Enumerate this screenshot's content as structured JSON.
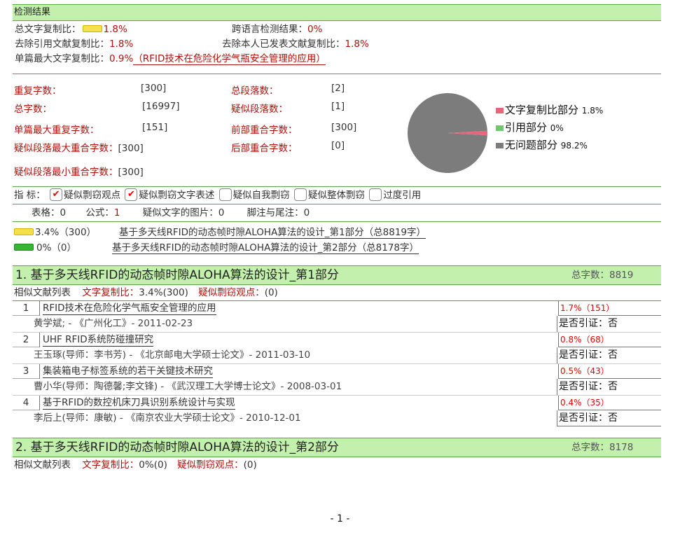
{
  "header": {
    "title": "检测结果"
  },
  "summary": {
    "total_copy_label": "总文字复制比：",
    "total_copy_value": "1.8%",
    "cross_lang_label": "跨语言检测结果：",
    "cross_lang_value": "0%",
    "excl_ref_label": "去除引用文献复制比：",
    "excl_ref_value": "1.8%",
    "excl_self_label": "去除本人已发表文献复制比：",
    "excl_self_value": "1.8%",
    "single_max_label": "单篇最大文字复制比：",
    "single_max_value": "0.9%",
    "single_max_title": "（RFID技术在危险化学气瓶安全管理的应用）"
  },
  "stats": {
    "dup_chars_label": "重复字数：",
    "dup_chars": "[300]",
    "total_paras_label": "总段落数：",
    "total_paras": "[2]",
    "total_chars_label": "总字数：",
    "total_chars": "[16997]",
    "susp_paras_label": "疑似段落数：",
    "susp_paras": "[1]",
    "single_max_dup_label": "单篇最大重复字数：",
    "single_max_dup": "[151]",
    "front_overlap_label": "前部重合字数：",
    "front_overlap": "[300]",
    "para_max_label": "疑似段落最大重合字数：",
    "para_max": "[300]",
    "back_overlap_label": "后部重合字数：",
    "back_overlap": "[0]",
    "para_min_label": "疑似段落最小重合字数：",
    "para_min": "[300]"
  },
  "chart_data": {
    "type": "pie",
    "categories": [
      "文字复制比部分",
      "引用部分",
      "无问题部分"
    ],
    "values": [
      1.8,
      0,
      98.2
    ],
    "labels": [
      "1.8%",
      "0%",
      "98.2%"
    ],
    "colors": [
      "#e8657a",
      "#6fc76f",
      "#7c7c7c"
    ]
  },
  "indicators": {
    "label": "指 标：",
    "items": [
      {
        "text": "疑似剽窃观点",
        "checked": true
      },
      {
        "text": "疑似剽窃文字表述",
        "checked": true
      },
      {
        "text": "疑似自我剽窃",
        "checked": false
      },
      {
        "text": "疑似整体剽窃",
        "checked": false
      },
      {
        "text": "过度引用",
        "checked": false
      }
    ],
    "check_mark": "✔"
  },
  "table_line": {
    "tables_label": "表格：",
    "tables": "0",
    "formula_label": "公式：",
    "formula": "1",
    "images_label": "疑似文字的图片：",
    "images": "0",
    "notes_label": "脚注与尾注：",
    "notes": "0"
  },
  "parts": [
    {
      "pct": "3.4%（300）",
      "title": "基于多天线RFID的动态帧时隙ALOHA算法的设计_第1部分（总8819字）"
    },
    {
      "pct": "0%（0）",
      "title": "基于多天线RFID的动态帧时隙ALOHA算法的设计_第2部分（总8178字）"
    }
  ],
  "sections": [
    {
      "title": "1. 基于多天线RFID的动态帧时隙ALOHA算法的设计_第1部分",
      "total": "总字数：8819",
      "list_label": "相似文献列表",
      "copy_label": "文字复制比：",
      "copy_value": "3.4%(300)",
      "plag_label": "疑似剽窃观点：",
      "plag_value": "(0)",
      "items": [
        {
          "num": "1",
          "title": "RFID技术在危险化学气瓶安全管理的应用",
          "pct": "1.7%（151）",
          "author": "黄学斌; - 《广州化工》- 2011-02-23",
          "cite": "是否引证：否"
        },
        {
          "num": "2",
          "title": "UHF RFID系统防碰撞研究",
          "pct": "0.8%（68）",
          "author": "王玉琢(导师：李书芳) - 《北京邮电大学硕士论文》- 2011-03-10",
          "cite": "是否引证：否"
        },
        {
          "num": "3",
          "title": "集装箱电子标签系统的若干关键技术研究",
          "pct": "0.5%（43）",
          "author": "曹小华(导师：陶德馨;李文锋) - 《武汉理工大学博士论文》- 2008-03-01",
          "cite": "是否引证：否"
        },
        {
          "num": "4",
          "title": "基于RFID的数控机床刀具识别系统设计与实现",
          "pct": "0.4%（35）",
          "author": "李后上(导师：康敏) - 《南京农业大学硕士论文》- 2010-12-01",
          "cite": "是否引证：否"
        }
      ]
    },
    {
      "title": "2. 基于多天线RFID的动态帧时隙ALOHA算法的设计_第2部分",
      "total": "总字数：8178",
      "list_label": "相似文献列表",
      "copy_label": "文字复制比：",
      "copy_value": "0%(0)",
      "plag_label": "疑似剽窃观点：",
      "plag_value": "(0)"
    }
  ],
  "footer": {
    "page": "- 1 -"
  }
}
